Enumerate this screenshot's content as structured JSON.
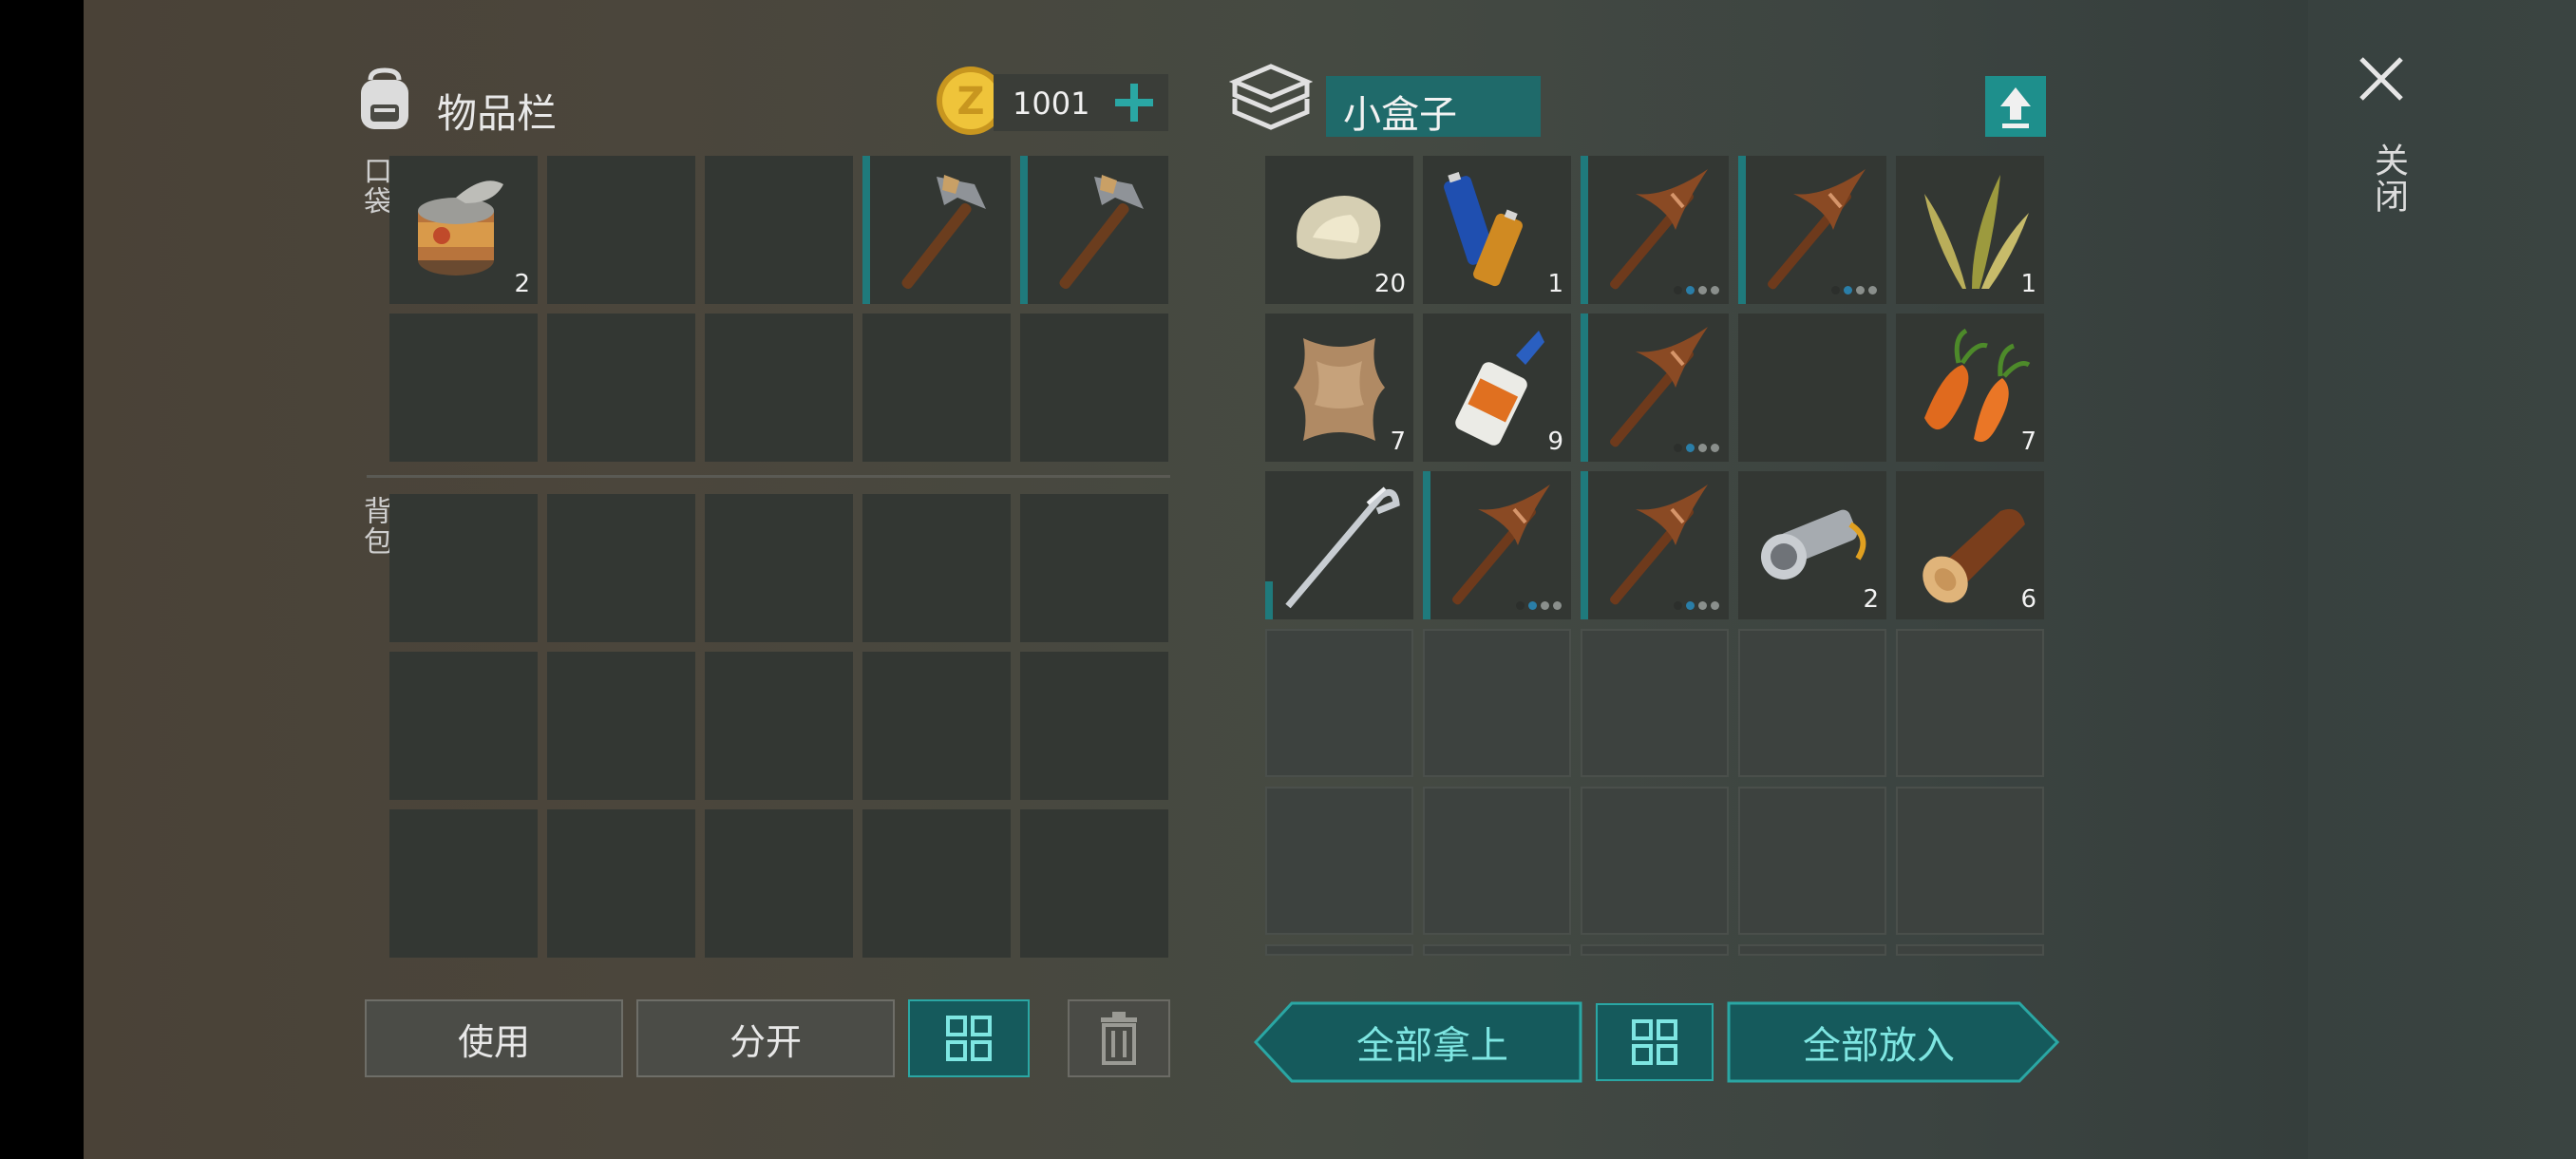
{
  "inventory": {
    "title": "物品栏",
    "coins": "1001",
    "pocket_label": "口袋",
    "backpack_label": "背包",
    "pocket_slots": [
      {
        "item": "tin-can",
        "count": "2"
      },
      {
        "item": "empty"
      },
      {
        "item": "empty"
      },
      {
        "item": "stone-hammer"
      },
      {
        "item": "stone-hammer"
      },
      {
        "item": "empty"
      },
      {
        "item": "empty"
      },
      {
        "item": "empty"
      },
      {
        "item": "empty"
      },
      {
        "item": "empty"
      }
    ],
    "backpack_slots": 15
  },
  "container": {
    "name": "小盒子",
    "slots": [
      {
        "item": "stone",
        "count": "20"
      },
      {
        "item": "batteries",
        "count": "1"
      },
      {
        "item": "wooden-pickaxe",
        "durability_pips": 3,
        "pips_filled": 1
      },
      {
        "item": "wooden-pickaxe",
        "durability_pips": 3,
        "pips_filled": 1
      },
      {
        "item": "plant-fiber",
        "count": "1"
      },
      {
        "item": "animal-hide",
        "count": "7"
      },
      {
        "item": "glue",
        "count": "9"
      },
      {
        "item": "wooden-pickaxe",
        "durability_pips": 3,
        "pips_filled": 1
      },
      {
        "item": "empty"
      },
      {
        "item": "carrot",
        "count": "7"
      },
      {
        "item": "metal-hook"
      },
      {
        "item": "wooden-pickaxe",
        "durability_pips": 3,
        "pips_filled": 1
      },
      {
        "item": "wooden-pickaxe",
        "durability_pips": 3,
        "pips_filled": 1
      },
      {
        "item": "flashlight",
        "count": "2"
      },
      {
        "item": "log",
        "count": "6"
      }
    ],
    "empty_rows": 3
  },
  "actions": {
    "use": "使用",
    "split": "分开",
    "take_all": "全部拿上",
    "put_all": "全部放入"
  },
  "close_label": "关闭",
  "colors": {
    "teal": "#2aa7a4",
    "teal_dark": "#155a5c",
    "coin": "#e0b52a"
  },
  "icons": [
    "backpack-icon",
    "coin-icon",
    "plus-icon",
    "box-stack-icon",
    "upload-icon",
    "grid-icon",
    "trash-icon",
    "close-icon"
  ]
}
